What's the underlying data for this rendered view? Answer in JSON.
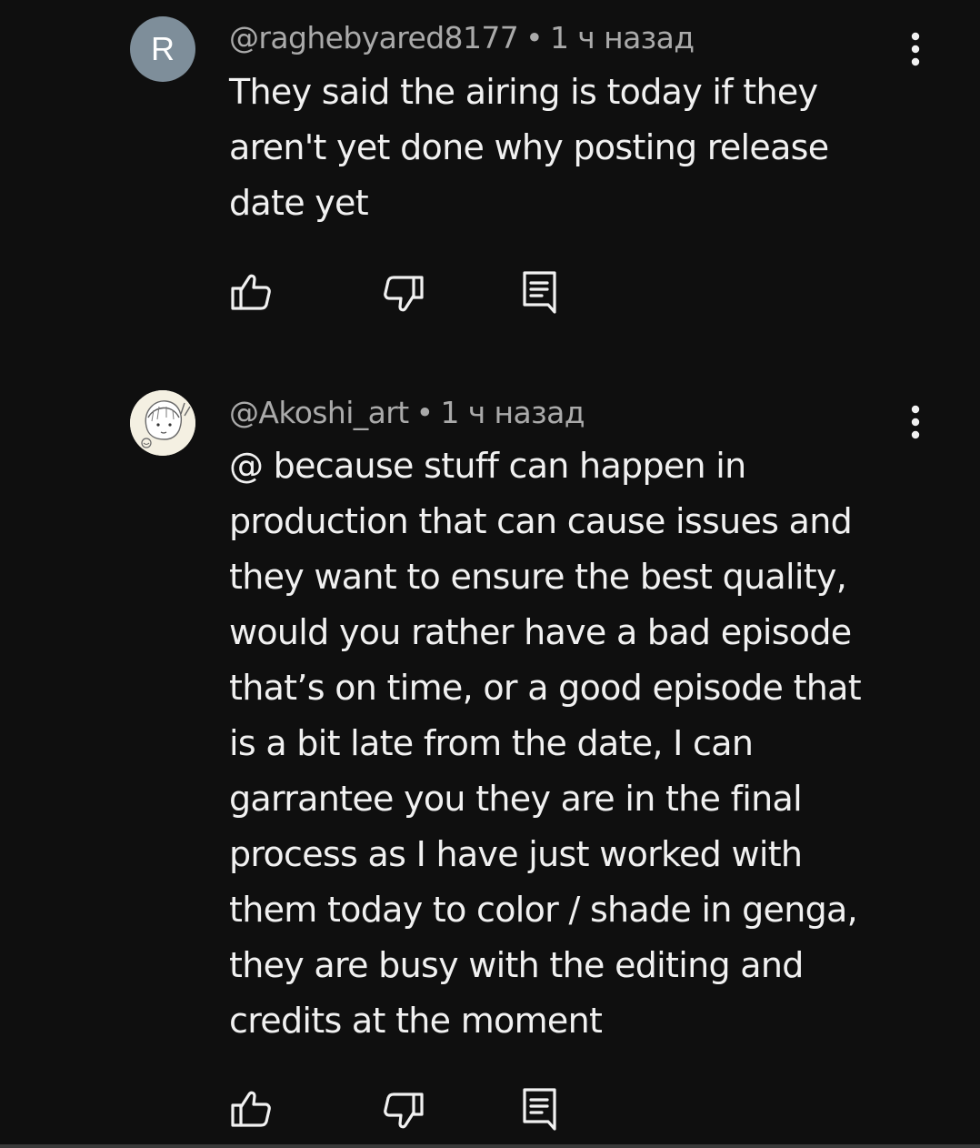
{
  "comments": [
    {
      "avatar_letter": "R",
      "author": "@raghebyared8177",
      "separator": "•",
      "time": "1 ч назад",
      "text": "They said the airing is today if they\naren't yet done why posting release\ndate yet",
      "icons": {
        "more": "more-vert-icon",
        "like": "thumb-up-icon",
        "dislike": "thumb-down-icon",
        "reply": "reply-icon"
      },
      "avatar_color": "#7e8e9a"
    },
    {
      "avatar_letter": "",
      "author": "@Akoshi_art",
      "separator": "•",
      "time": "1 ч назад",
      "text": "@ because stuff can happen in\nproduction that can cause issues and\nthey want to ensure the best quality,\nwould you rather have a bad episode\nthat’s on time, or a good episode that\nis a bit late from the date, I can\ngarrantee you they are in the final\nprocess as I have just worked with\nthem today to color / shade in genga,\nthey are busy with the editing and\ncredits at the moment",
      "icons": {
        "more": "more-vert-icon",
        "like": "thumb-up-icon",
        "dislike": "thumb-down-icon",
        "reply": "reply-icon"
      },
      "avatar_color": "#f4f0e2"
    }
  ],
  "colors": {
    "background": "#0f0f0f",
    "text_primary": "#f1f1f1",
    "text_secondary": "#aaaaaa"
  }
}
